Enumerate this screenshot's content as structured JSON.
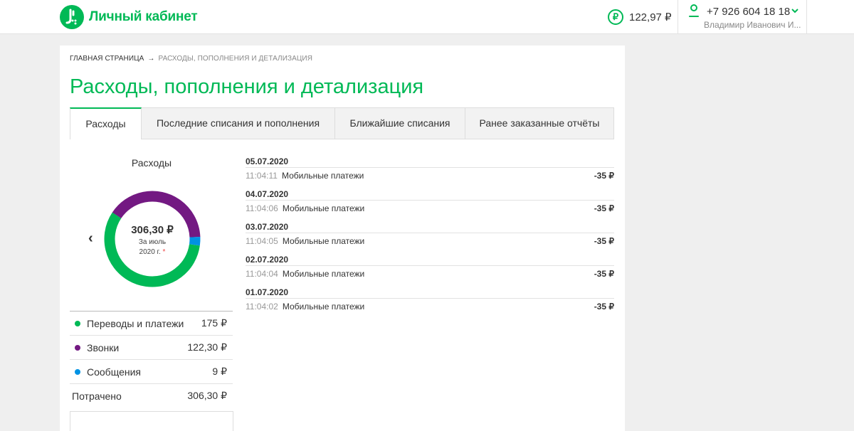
{
  "header": {
    "brand": "Личный кабинет",
    "balance": "122,97 ₽",
    "currency_symbol": "₽",
    "phone": "+7 926 604 18 18",
    "username": "Владимир Иванович И..."
  },
  "breadcrumb": {
    "home": "Главная страница",
    "arrow": "→",
    "current": "Расходы, пополнения и детализация"
  },
  "page_title": "Расходы, пополнения и детализация",
  "tabs": [
    {
      "label": "Расходы",
      "active": true
    },
    {
      "label": "Последние списания и пополнения",
      "active": false
    },
    {
      "label": "Ближайшие списания",
      "active": false
    },
    {
      "label": "Ранее заказанные отчёты",
      "active": false
    }
  ],
  "expenses": {
    "title": "Расходы",
    "prev": "‹",
    "total_amount": "306,30 ₽",
    "period_line1": "За июль",
    "period_line2": "2020 г.",
    "star": "*",
    "categories": [
      {
        "label": "Переводы и платежи",
        "value": "175 ₽",
        "amount": 175,
        "color": "#00b956"
      },
      {
        "label": "Звонки",
        "value": "122,30 ₽",
        "amount": 122.3,
        "color": "#731982"
      },
      {
        "label": "Сообщения",
        "value": "9 ₽",
        "amount": 9,
        "color": "#0092e4"
      }
    ],
    "total_label": "Потрачено",
    "total_value": "306,30 ₽"
  },
  "transactions": [
    {
      "date": "05.07.2020",
      "time": "11:04:11",
      "name": "Мобильные платежи",
      "amount": "-35 ₽"
    },
    {
      "date": "04.07.2020",
      "time": "11:04:06",
      "name": "Мобильные платежи",
      "amount": "-35 ₽"
    },
    {
      "date": "03.07.2020",
      "time": "11:04:05",
      "name": "Мобильные платежи",
      "amount": "-35 ₽"
    },
    {
      "date": "02.07.2020",
      "time": "11:04:04",
      "name": "Мобильные платежи",
      "amount": "-35 ₽"
    },
    {
      "date": "01.07.2020",
      "time": "11:04:02",
      "name": "Мобильные платежи",
      "amount": "-35 ₽"
    }
  ]
}
